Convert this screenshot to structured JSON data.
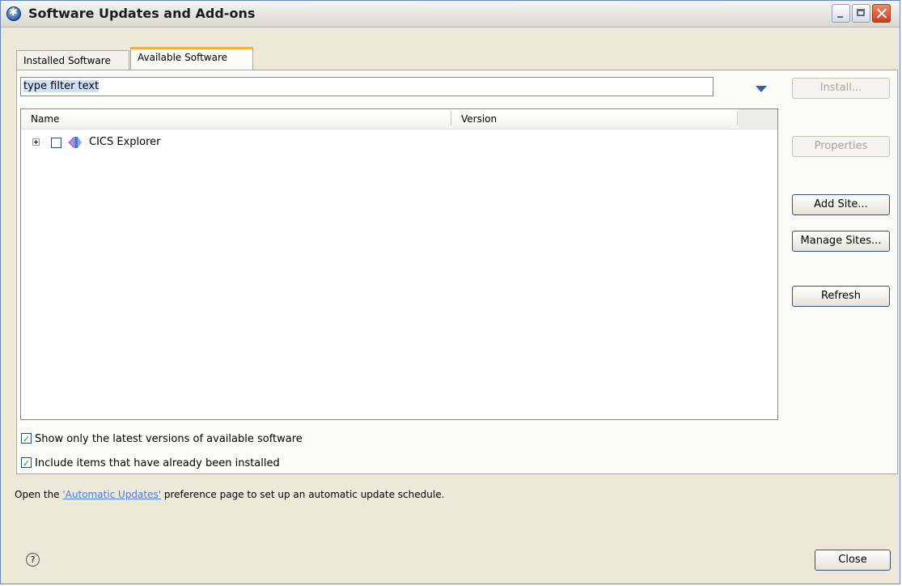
{
  "window": {
    "title": "Software Updates and Add-ons"
  },
  "tabs": [
    {
      "label": "Installed Software"
    },
    {
      "label": "Available Software"
    }
  ],
  "filter": {
    "value": "type filter text"
  },
  "table": {
    "columns": [
      "Name",
      "Version"
    ],
    "rows": [
      {
        "name": "CICS Explorer",
        "version": "",
        "checked": false
      }
    ]
  },
  "buttons": {
    "install": "Install...",
    "properties": "Properties",
    "add_site": "Add Site...",
    "manage_sites": "Manage Sites...",
    "refresh": "Refresh",
    "close": "Close"
  },
  "options": {
    "latest_only": {
      "label": "Show only the latest versions of available software",
      "checked": true
    },
    "include_installed": {
      "label": "Include items that have already been installed",
      "checked": true
    }
  },
  "footer": {
    "prefix": "Open the ",
    "link": "'Automatic Updates'",
    "suffix": " preference page to set up an automatic update schedule."
  },
  "help": {
    "glyph": "?"
  }
}
